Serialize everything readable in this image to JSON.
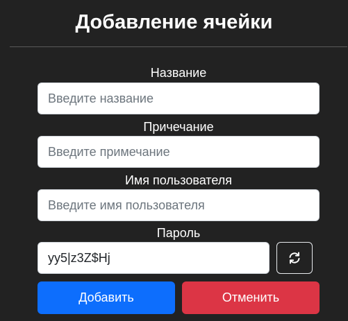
{
  "modal": {
    "title": "Добавление ячейки"
  },
  "form": {
    "name": {
      "label": "Название",
      "placeholder": "Введите название",
      "value": ""
    },
    "note": {
      "label": "Причечание",
      "placeholder": "Введите примечание",
      "value": ""
    },
    "username": {
      "label": "Имя пользователя",
      "placeholder": "Введите имя пользователя",
      "value": ""
    },
    "password": {
      "label": "Пароль",
      "value": "yy5|z3Z$Hj"
    }
  },
  "buttons": {
    "add_label": "Добавить",
    "cancel_label": "Отменить",
    "regenerate_icon": "refresh-icon"
  },
  "colors": {
    "background": "#222222",
    "primary": "#0d6efd",
    "danger": "#dc3545"
  }
}
